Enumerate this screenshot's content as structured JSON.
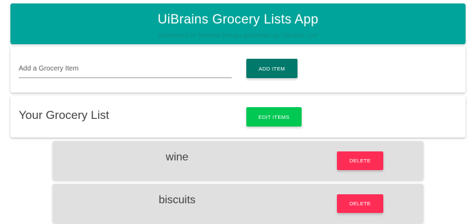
{
  "colors": {
    "header_bg": "#00a49a",
    "add_button": "#00796b",
    "edit_button": "#00c853",
    "delete_button": "#ff2d55",
    "item_bg": "#e0e0e0"
  },
  "header": {
    "title": "UiBrains Grocery Lists App",
    "subtitle": "Developed on Material Design guidelines by UiBrains.com"
  },
  "add_item": {
    "placeholder": "Add a Grocery Item",
    "value": "",
    "button_label": "ADD ITEM"
  },
  "list": {
    "title": "Your Grocery List",
    "edit_label": "EDIT ITEMS",
    "items": [
      {
        "name": "wine",
        "delete_label": "DELETE"
      },
      {
        "name": "biscuits",
        "delete_label": "DELETE"
      }
    ]
  }
}
